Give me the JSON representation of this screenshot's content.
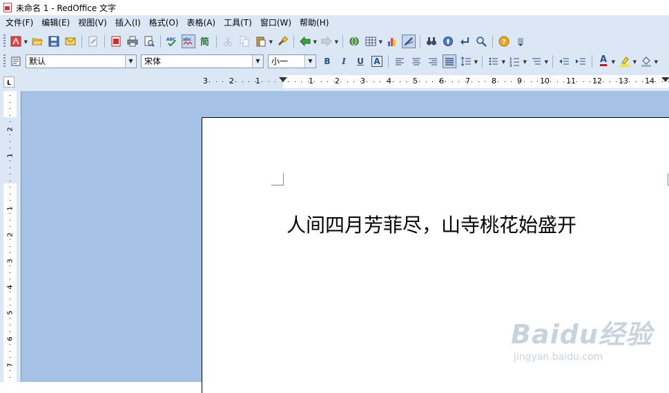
{
  "window": {
    "title": "未命名 1 - RedOffice 文字"
  },
  "menu": {
    "items": [
      "文件(F)",
      "编辑(E)",
      "视图(V)",
      "插入(I)",
      "格式(O)",
      "表格(A)",
      "工具(T)",
      "窗口(W)",
      "帮助(H)"
    ]
  },
  "format_toolbar": {
    "style": "默认",
    "font": "宋体",
    "size": "小一",
    "bold": "B",
    "italic": "I",
    "underline": "U",
    "shadow": "A",
    "font_color": "A"
  },
  "ruler": {
    "h_labels": [
      "3",
      "2",
      "1",
      "1",
      "2",
      "3",
      "4",
      "5",
      "6",
      "7",
      "8",
      "9",
      "10",
      "11",
      "12",
      "13",
      "14"
    ],
    "v_labels": [
      "2",
      "1",
      "1",
      "2",
      "3",
      "4",
      "5",
      "6",
      "7"
    ],
    "corner": "L"
  },
  "document": {
    "text": "人间四月芳菲尽，山寺桃花始盛开"
  },
  "watermark": {
    "main": "Baidu经验",
    "sub": "jingyan.baidu.com"
  },
  "colors": {
    "chrome": "#dce7f5",
    "workspace": "#a6c1e6",
    "page": "#ffffff"
  }
}
